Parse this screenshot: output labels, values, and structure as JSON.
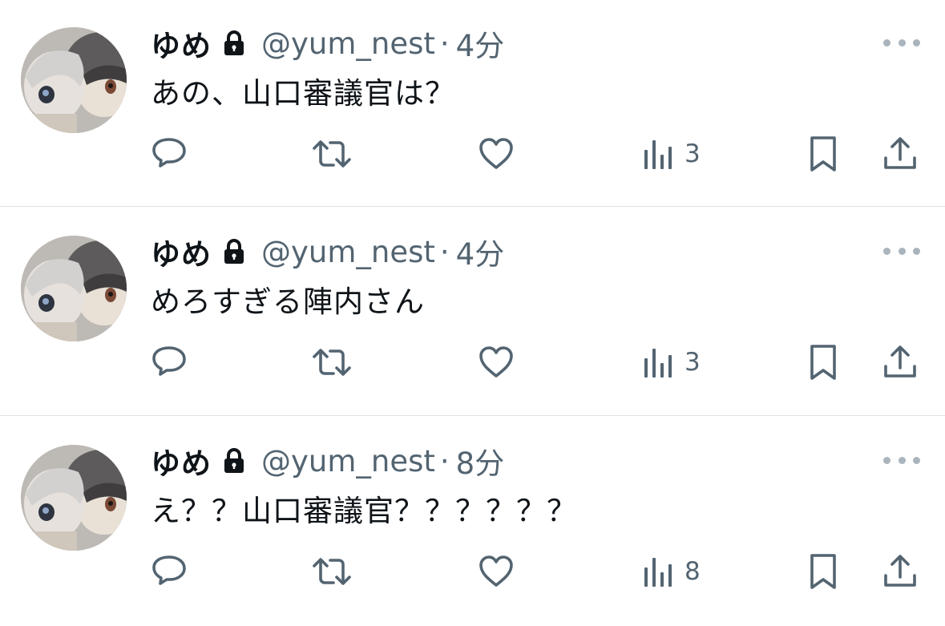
{
  "tweets": [
    {
      "name": "ゆめ",
      "handle": "@yum_nest",
      "separator": "·",
      "time": "4分",
      "text": "あの、山口審議官は？",
      "views": "3"
    },
    {
      "name": "ゆめ",
      "handle": "@yum_nest",
      "separator": "·",
      "time": "4分",
      "text": "めろすぎる陣内さん",
      "views": "3"
    },
    {
      "name": "ゆめ",
      "handle": "@yum_nest",
      "separator": "·",
      "time": "8分",
      "text": "え？？山口審議官？？？？？？",
      "views": "8"
    }
  ],
  "icons": {
    "lock": "lock-icon",
    "more": "more-icon",
    "reply": "reply-icon",
    "retweet": "retweet-icon",
    "like": "heart-icon",
    "views": "views-icon",
    "bookmark": "bookmark-icon",
    "share": "share-icon"
  },
  "colors": {
    "text_primary": "#0f1419",
    "text_secondary": "#536471",
    "divider": "#dfe3e7",
    "more_dots": "#aab4bd"
  }
}
